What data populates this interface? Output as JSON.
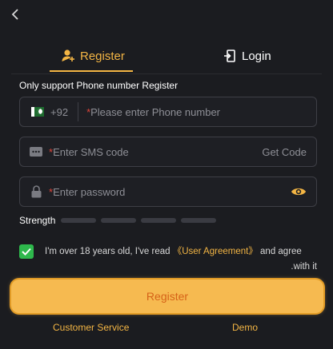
{
  "header": {
    "back_icon": "chevron-left-icon"
  },
  "tabs": [
    {
      "label": "Register",
      "icon": "user-add-icon",
      "active": true
    },
    {
      "label": "Login",
      "icon": "login-door-icon",
      "active": false
    }
  ],
  "hint": "Only support Phone number Register",
  "phone": {
    "country_code": "+92",
    "flag": "pakistan-flag",
    "required_mark": "*",
    "placeholder": "Please enter Phone number"
  },
  "sms": {
    "required_mark": "*",
    "placeholder": "Enter SMS code",
    "get_code_label": "Get Code"
  },
  "password": {
    "required_mark": "*",
    "placeholder": "Enter password"
  },
  "strength": {
    "label": "Strength",
    "level": 0,
    "segments": 4
  },
  "agreement": {
    "checked": true,
    "text_before": "I'm over 18 years old, I've read ",
    "link_label": "《User Agreement》",
    "text_after": " and agree",
    "text_line2": ".with it"
  },
  "register_button_label": "Register",
  "footer": {
    "customer_service_label": "Customer Service",
    "demo_label": "Demo"
  },
  "colors": {
    "accent": "#f3b544",
    "button": "#f6ba50",
    "button_text": "#d66318",
    "check": "#2eb84c",
    "required": "#e0453a"
  }
}
